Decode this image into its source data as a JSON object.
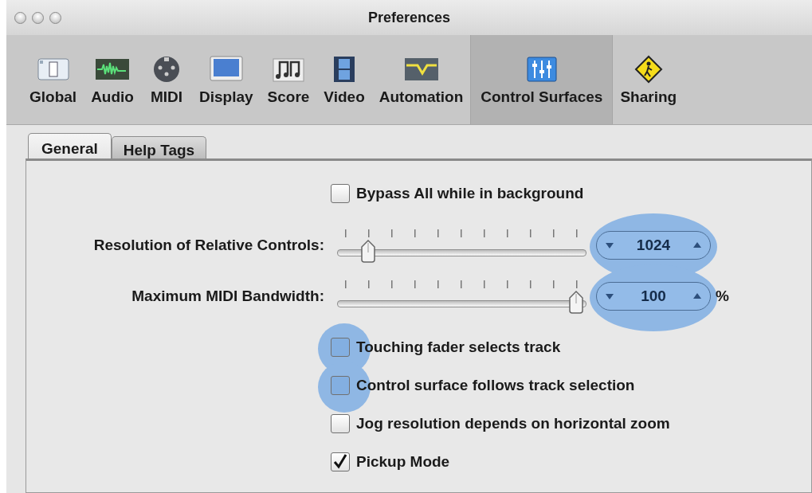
{
  "window": {
    "title": "Preferences"
  },
  "toolbar": [
    {
      "label": "Global",
      "selected": false
    },
    {
      "label": "Audio",
      "selected": false
    },
    {
      "label": "MIDI",
      "selected": false
    },
    {
      "label": "Display",
      "selected": false
    },
    {
      "label": "Score",
      "selected": false
    },
    {
      "label": "Video",
      "selected": false
    },
    {
      "label": "Automation",
      "selected": false
    },
    {
      "label": "Control Surfaces",
      "selected": true
    },
    {
      "label": "Sharing",
      "selected": false
    }
  ],
  "tabs": [
    {
      "label": "General",
      "selected": true
    },
    {
      "label": "Help Tags",
      "selected": false
    }
  ],
  "controls": [
    {
      "kind": "checkbox",
      "label": "Bypass All while in background",
      "checked": false,
      "highlighted": false
    },
    {
      "kind": "slider",
      "label": "Resolution of Relative Controls:",
      "level": 0.1,
      "value": "1024",
      "highlighted": true
    },
    {
      "kind": "slider",
      "label": "Maximum MIDI Bandwidth:",
      "level": 1,
      "value": "100",
      "unit": "%",
      "highlighted": true
    },
    {
      "kind": "checkbox",
      "label": "Touching fader selects track",
      "checked": false,
      "highlighted": true
    },
    {
      "kind": "checkbox",
      "label": "Control surface follows track selection",
      "checked": false,
      "highlighted": true
    },
    {
      "kind": "checkbox",
      "label": "Jog resolution depends on horizontal zoom",
      "checked": false,
      "highlighted": false
    },
    {
      "kind": "checkbox",
      "label": "Pickup Mode",
      "checked": true,
      "highlighted": false
    }
  ]
}
